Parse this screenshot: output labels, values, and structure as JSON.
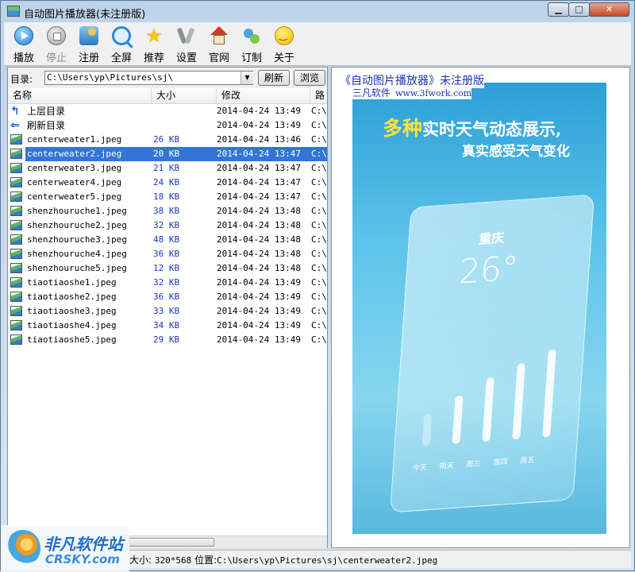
{
  "window": {
    "title": "自动图片播放器(未注册版)"
  },
  "toolbar": {
    "play": "播放",
    "stop": "停止",
    "register": "注册",
    "fullscreen": "全屏",
    "recommend": "推荐",
    "settings": "设置",
    "website": "官网",
    "subscribe": "订制",
    "about": "关于"
  },
  "pathbar": {
    "label": "目录:",
    "value": "C:\\Users\\yp\\Pictures\\sj\\",
    "refresh": "刷新",
    "browse": "浏览"
  },
  "columns": {
    "name": "名称",
    "size": "大小",
    "modified": "修改",
    "path": "路"
  },
  "rows": [
    {
      "name": "上层目录",
      "size": "",
      "date": "2014-04-24 13:49",
      "path": "C:\\"
    },
    {
      "name": "刷新目录",
      "size": "",
      "date": "2014-04-24 13:49",
      "path": "C:\\"
    },
    {
      "name": "centerweater1.jpeg",
      "size": "26 KB",
      "date": "2014-04-24 13:46",
      "path": "C:\\"
    },
    {
      "name": "centerweater2.jpeg",
      "size": "20 KB",
      "date": "2014-04-24 13:47",
      "path": "C:\\"
    },
    {
      "name": "centerweater3.jpeg",
      "size": "21 KB",
      "date": "2014-04-24 13:47",
      "path": "C:\\"
    },
    {
      "name": "centerweater4.jpeg",
      "size": "24 KB",
      "date": "2014-04-24 13:47",
      "path": "C:\\"
    },
    {
      "name": "centerweater5.jpeg",
      "size": "18 KB",
      "date": "2014-04-24 13:47",
      "path": "C:\\"
    },
    {
      "name": "shenzhouruche1.jpeg",
      "size": "38 KB",
      "date": "2014-04-24 13:48",
      "path": "C:\\"
    },
    {
      "name": "shenzhouruche2.jpeg",
      "size": "32 KB",
      "date": "2014-04-24 13:48",
      "path": "C:\\"
    },
    {
      "name": "shenzhouruche3.jpeg",
      "size": "48 KB",
      "date": "2014-04-24 13:48",
      "path": "C:\\"
    },
    {
      "name": "shenzhouruche4.jpeg",
      "size": "36 KB",
      "date": "2014-04-24 13:48",
      "path": "C:\\"
    },
    {
      "name": "shenzhouruche5.jpeg",
      "size": "12 KB",
      "date": "2014-04-24 13:48",
      "path": "C:\\"
    },
    {
      "name": "tiaotiaoshe1.jpeg",
      "size": "32 KB",
      "date": "2014-04-24 13:49",
      "path": "C:\\"
    },
    {
      "name": "tiaotiaoshe2.jpeg",
      "size": "36 KB",
      "date": "2014-04-24 13:49",
      "path": "C:\\"
    },
    {
      "name": "tiaotiaoshe3.jpeg",
      "size": "33 KB",
      "date": "2014-04-24 13:49",
      "path": "C:\\"
    },
    {
      "name": "tiaotiaoshe4.jpeg",
      "size": "34 KB",
      "date": "2014-04-24 13:49",
      "path": "C:\\"
    },
    {
      "name": "tiaotiaoshe5.jpeg",
      "size": "29 KB",
      "date": "2014-04-24 13:49",
      "path": "C:\\"
    }
  ],
  "selected_index": 3,
  "preview": {
    "watermark_title": "《自动图片播放器》未注册版",
    "watermark_company": "三凡软件",
    "watermark_url": "www.3fwork.com",
    "headline_highlight": "多种",
    "headline_rest": "实时天气动态展示,",
    "subheadline": "真实感受天气变化",
    "city": "重庆",
    "temperature": "26°",
    "days": [
      "今天",
      "明天",
      "周三",
      "周四",
      "周五"
    ]
  },
  "status": {
    "size_label": "大小:",
    "size_value": "320*568",
    "location_label": "位置:",
    "location_value": "C:\\Users\\yp\\Pictures\\sj\\centerweater2.jpeg"
  },
  "logo": {
    "cn": "非凡软件站",
    "en": "CRSKY.com"
  }
}
